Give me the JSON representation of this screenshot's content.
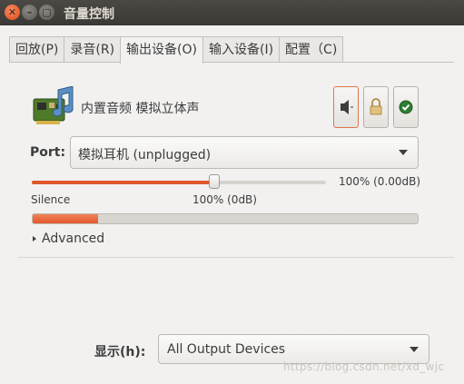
{
  "window": {
    "title": "音量控制",
    "close_glyph": "✕",
    "min_glyph": "–",
    "max_glyph": "▢"
  },
  "tabs": [
    {
      "label": "回放(P)",
      "active": false
    },
    {
      "label": "录音(R)",
      "active": false
    },
    {
      "label": "输出设备(O)",
      "active": true
    },
    {
      "label": "输入设备(I)",
      "active": false
    },
    {
      "label": "配置（C)",
      "active": false
    }
  ],
  "device": {
    "name": "内置音频 模拟立体声",
    "icon": "sound-card-icon",
    "mute_icon": "speaker-icon",
    "lock_icon": "lock-icon",
    "default_icon": "checkmark-icon"
  },
  "port": {
    "label": "Port:",
    "value": "模拟耳机 (unplugged)"
  },
  "volume": {
    "readout": "100% (0.00dB)",
    "level_fraction": 0.62,
    "tick_silence": "Silence",
    "tick_100": "100% (0dB)"
  },
  "meter": {
    "level_fraction": 0.17
  },
  "advanced": {
    "label": "Advanced"
  },
  "show": {
    "label": "显示(h):",
    "value": "All Output Devices"
  },
  "watermark": "https://blog.csdn.net/xd_wjc",
  "colors": {
    "accent": "#e0562b",
    "titlebar": "#3c3b37",
    "window_bg": "#f2f1f0"
  }
}
